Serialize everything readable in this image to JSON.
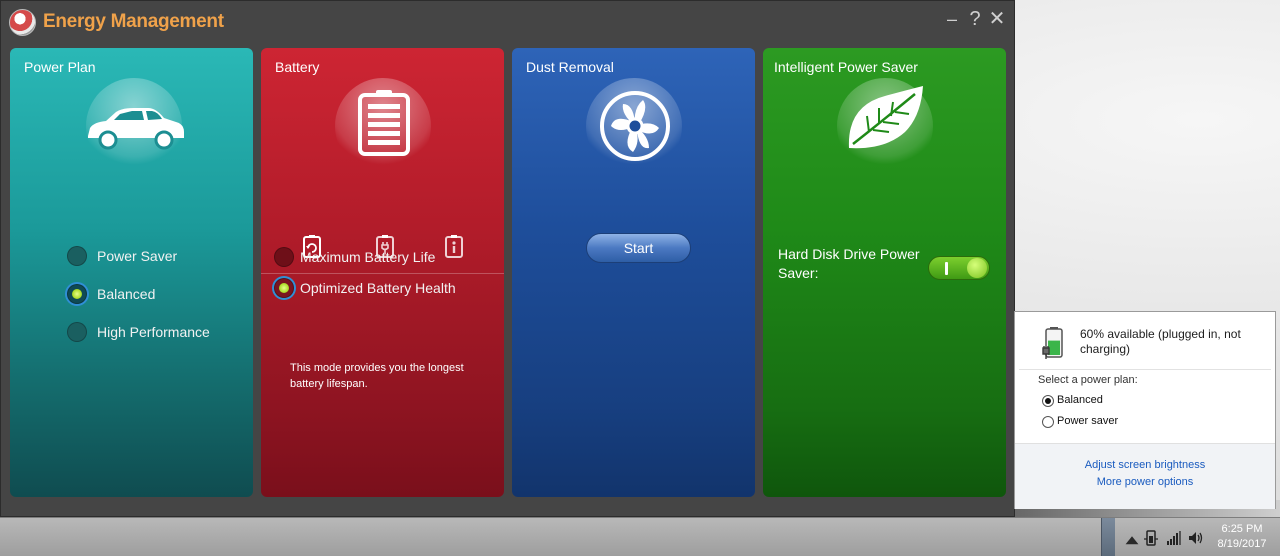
{
  "app": {
    "title": "Energy Management",
    "controls": {
      "minimize": "–",
      "help": "?",
      "close": "✕"
    }
  },
  "panels": {
    "power_plan": {
      "title": "Power Plan",
      "icon": "car-icon",
      "options": [
        {
          "label": "Power Saver",
          "selected": false
        },
        {
          "label": "Balanced",
          "selected": true
        },
        {
          "label": "High Performance",
          "selected": false
        }
      ]
    },
    "battery": {
      "title": "Battery",
      "icon": "battery-icon",
      "tabs": [
        "battery-refresh-icon",
        "battery-plug-icon",
        "battery-info-icon"
      ],
      "options": [
        {
          "label": "Maximum Battery Life",
          "selected": false
        },
        {
          "label": "Optimized Battery Health",
          "selected": true
        }
      ],
      "description": "This mode provides you the longest battery lifespan."
    },
    "dust_removal": {
      "title": "Dust Removal",
      "icon": "fan-icon",
      "start_label": "Start"
    },
    "intelligent_power_saver": {
      "title": "Intelligent Power Saver",
      "icon": "leaf-icon",
      "hdd_label": "Hard Disk Drive Power Saver:",
      "hdd_enabled": true
    }
  },
  "flyout": {
    "status": "60% available (plugged in, not charging)",
    "battery_level": 0.6,
    "plan_label": "Select a power plan:",
    "plans": [
      {
        "label": "Balanced",
        "selected": true
      },
      {
        "label": "Power saver",
        "selected": false
      }
    ],
    "links": [
      "Adjust screen brightness",
      "More power options"
    ]
  },
  "taskbar": {
    "time": "6:25 PM",
    "date": "8/19/2017"
  },
  "colors": {
    "power_plan": "#1b9a9a",
    "battery": "#b21c2a",
    "dust_removal": "#1e4e9b",
    "intelligent_power_saver": "#1f8a18",
    "title_accent": "#f0a24a"
  }
}
